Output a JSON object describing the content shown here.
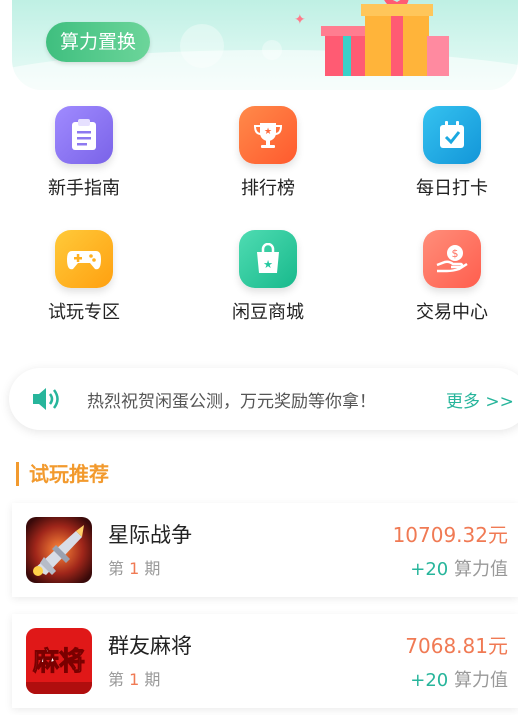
{
  "banner": {
    "tag": "算力置换"
  },
  "menu": [
    {
      "label": "新手指南",
      "icon": "clipboard-icon",
      "color": "#8d79f0"
    },
    {
      "label": "排行榜",
      "icon": "trophy-icon",
      "color": "#ff6a3d"
    },
    {
      "label": "每日打卡",
      "icon": "calendar-check-icon",
      "color": "#1aa8e0"
    },
    {
      "label": "试玩专区",
      "icon": "gamepad-icon",
      "color": "#ffb020"
    },
    {
      "label": "闲豆商城",
      "icon": "shopping-bag-icon",
      "color": "#25c9a0"
    },
    {
      "label": "交易中心",
      "icon": "hand-coin-icon",
      "color": "#ff6f5e"
    }
  ],
  "notice": {
    "text": "热烈祝贺闲蛋公测，万元奖励等你拿！",
    "more": "更多 >>"
  },
  "section": {
    "title": "试玩推荐"
  },
  "games": [
    {
      "name": "星际战争",
      "period_prefix": "第",
      "period_num": "1",
      "period_suffix": "期",
      "amount": "10709.32元",
      "reward_plus": "+20",
      "reward_unit": "算力值"
    },
    {
      "name": "群友麻将",
      "period_prefix": "第",
      "period_num": "1",
      "period_suffix": "期",
      "amount": "7068.81元",
      "reward_plus": "+20",
      "reward_unit": "算力值",
      "logo_text": "麻将"
    }
  ]
}
